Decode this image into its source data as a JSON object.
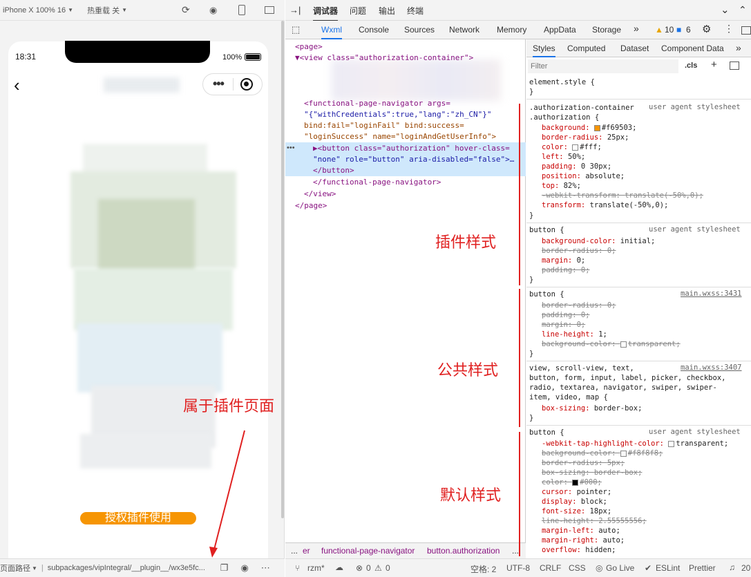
{
  "simulator": {
    "device": "iPhone X 100% 16",
    "hot_reload": "热重载 关",
    "time": "18:31",
    "battery": "100%",
    "auth_button": "授权插件使用",
    "page_path_label": "页面路径",
    "page_path": "subpackages/vipIntegral/__plugin__/wx3e5fc..."
  },
  "devtools_top": {
    "tabs": [
      "调试器",
      "问题",
      "输出",
      "终端"
    ]
  },
  "devtools_tabs": {
    "items": [
      "Wxml",
      "Console",
      "Sources",
      "Network",
      "Memory",
      "AppData",
      "Storage"
    ],
    "more": "»",
    "warn_count": "10",
    "info_count": "6"
  },
  "elements": {
    "lines": [
      "<page>",
      "▼<view class=\"authorization-container\">",
      "<functional-page-navigator args=",
      "\"{\"withCredentials\":true,\"lang\":\"zh_CN\"}\"",
      "bind:fail=\"loginFail\" bind:success=",
      "\"loginSuccess\" name=\"loginAndGetUserInfo\">",
      "▶<button class=\"authorization\" hover-class=",
      "\"none\" role=\"button\" aria-disabled=\"false\">…",
      "</button>",
      "</functional-page-navigator>",
      "</view>",
      "</page>"
    ]
  },
  "breadcrumbs": {
    "dots": "...",
    "c0": "er",
    "c1": "functional-page-navigator",
    "c2": "button.authorization",
    "c3": "..."
  },
  "styles": {
    "tabs": [
      "Styles",
      "Computed",
      "Dataset",
      "Component Data"
    ],
    "filter_placeholder": "Filter",
    "cls": ".cls",
    "element_style": "element.style {",
    "close": "}",
    "rule1_selector1": ".authorization-container",
    "rule1_selector2": ".authorization {",
    "rule1_source": "user agent stylesheet",
    "rule1_props": [
      {
        "name": "background",
        "value": "#f69503",
        "color": "#f69503"
      },
      {
        "name": "border-radius",
        "value": "25px"
      },
      {
        "name": "color",
        "value": "#fff",
        "color": "#ffffff"
      },
      {
        "name": "left",
        "value": "50%"
      },
      {
        "name": "padding",
        "value": "0 30px"
      },
      {
        "name": "position",
        "value": "absolute"
      },
      {
        "name": "top",
        "value": "82%"
      },
      {
        "name": "-webkit-transform",
        "value": "translate(-50%,0)",
        "strike": true
      },
      {
        "name": "transform",
        "value": "translate(-50%,0)"
      }
    ],
    "rule2_selector": "button {",
    "rule2_source": "user agent stylesheet",
    "rule2_props": [
      {
        "name": "background-color",
        "value": "initial"
      },
      {
        "name": "border-radius",
        "value": "0",
        "strike": true
      },
      {
        "name": "margin",
        "value": "0"
      },
      {
        "name": "padding",
        "value": "0",
        "strike": true
      }
    ],
    "rule3_selector": "button {",
    "rule3_source": "main.wxss:3431",
    "rule3_props": [
      {
        "name": "border-radius",
        "value": "0",
        "strike": true
      },
      {
        "name": "padding",
        "value": "0",
        "strike": true
      },
      {
        "name": "margin",
        "value": "0",
        "strike": true
      },
      {
        "name": "line-height",
        "value": "1"
      },
      {
        "name": "background-color",
        "value": "transparent",
        "strike": true,
        "color": "transparent"
      }
    ],
    "rule4_selector_lines": [
      "view, scroll-view, text,",
      "button, form, input, label, picker, checkbox,",
      "radio, textarea, navigator, swiper, swiper-",
      "item, video, map {"
    ],
    "rule4_source": "main.wxss:3407",
    "rule4_props": [
      {
        "name": "box-sizing",
        "value": "border-box"
      }
    ],
    "rule5_selector": "button {",
    "rule5_source": "user agent stylesheet",
    "rule5_props": [
      {
        "name": "-webkit-tap-highlight-color",
        "value": "transparent",
        "color": "transparent"
      },
      {
        "name": "background-color",
        "value": "#f8f8f8",
        "strike": true,
        "color": "#f8f8f8"
      },
      {
        "name": "border-radius",
        "value": "5px",
        "strike": true
      },
      {
        "name": "box-sizing",
        "value": "border-box",
        "strike": true
      },
      {
        "name": "color",
        "value": "#000",
        "strike": true,
        "color": "#000000"
      },
      {
        "name": "cursor",
        "value": "pointer"
      },
      {
        "name": "display",
        "value": "block"
      },
      {
        "name": "font-size",
        "value": "18px"
      },
      {
        "name": "line-height",
        "value": "2.55555556",
        "strike": true
      },
      {
        "name": "margin-left",
        "value": "auto"
      },
      {
        "name": "margin-right",
        "value": "auto"
      },
      {
        "name": "overflow",
        "value": "hidden"
      }
    ]
  },
  "annotations": {
    "plugin_style": "插件样式",
    "common_style": "公共样式",
    "default_style": "默认样式",
    "plugin_page": "属于插件页面"
  },
  "status": {
    "branch": "rzm*",
    "errors": "0",
    "warnings": "0",
    "spaces": "空格: 2",
    "encoding": "UTF-8",
    "eol": "CRLF",
    "lang": "CSS",
    "golive": "Go Live",
    "eslint": "ESLint",
    "prettier": "Prettier",
    "count": "20"
  },
  "colors": {
    "accent": "#f69503",
    "annotation": "#e02020",
    "selection": "#cfe8fc"
  }
}
